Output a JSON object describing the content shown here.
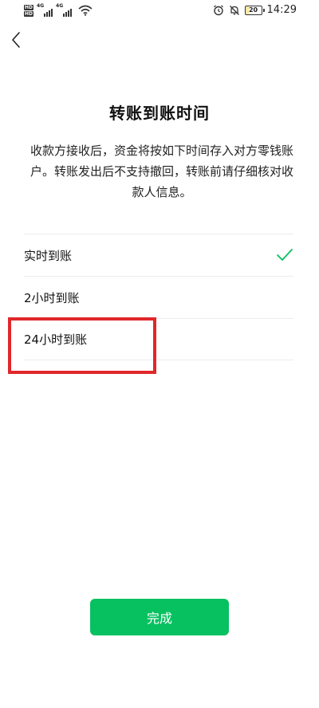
{
  "status_bar": {
    "sim1_tag": "HD",
    "sim2_tag": "HD",
    "net1_label": "4G",
    "net2_label": "4G",
    "battery": "20",
    "time": "14:29",
    "icons": [
      "alarm-icon",
      "mute-icon",
      "battery-icon",
      "wifi-icon",
      "signal-icon"
    ]
  },
  "nav": {
    "back_icon": "chevron-left-icon"
  },
  "page": {
    "title": "转账到账时间",
    "description": "收款方接收后，资金将按如下时间存入对方零钱账户。转账发出后不支持撤回，转账前请仔细核对收款人信息。"
  },
  "options": [
    {
      "label": "实时到账",
      "selected": true
    },
    {
      "label": "2小时到账",
      "selected": false
    },
    {
      "label": "24小时到账",
      "selected": false
    }
  ],
  "highlight_color": "#e0272b",
  "accent_color": "#07c160",
  "done_button": {
    "label": "完成"
  }
}
